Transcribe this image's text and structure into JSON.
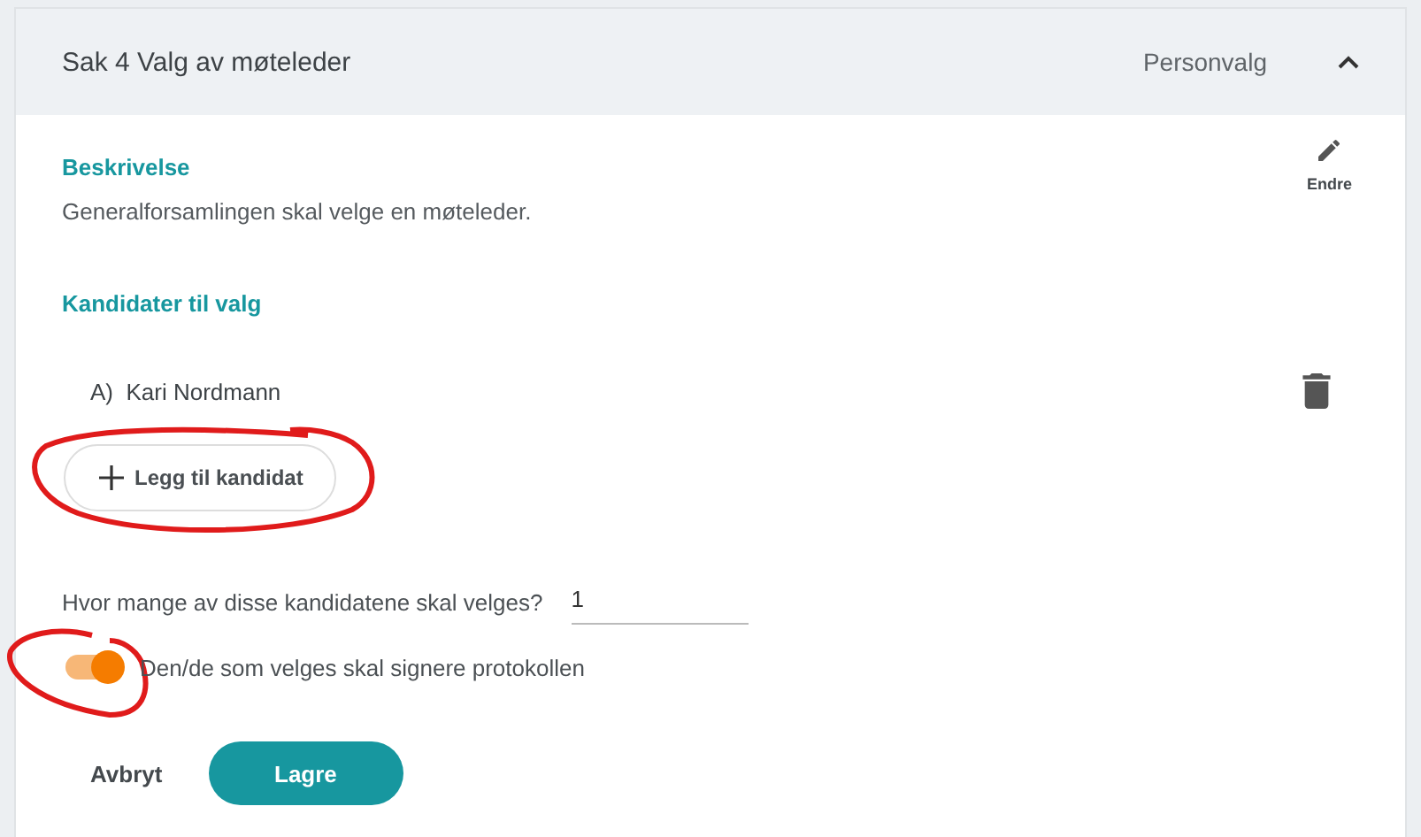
{
  "case": {
    "title": "Sak 4 Valg av møteleder",
    "type": "Personvalg",
    "expanded": true
  },
  "edit": {
    "label": "Endre"
  },
  "description": {
    "heading": "Beskrivelse",
    "text": "Generalforsamlingen skal velge en møteleder."
  },
  "candidates": {
    "heading": "Kandidater til valg",
    "items": [
      {
        "letter": "A)",
        "name": "Kari Nordmann"
      }
    ],
    "add_button": "Legg til kandidat"
  },
  "count_question": {
    "label": "Hvor mange av disse kandidatene skal velges?",
    "value": "1"
  },
  "sign_toggle": {
    "label": "Den/de som velges skal signere protokollen",
    "on": true
  },
  "buttons": {
    "cancel": "Avbryt",
    "save": "Lagre"
  }
}
